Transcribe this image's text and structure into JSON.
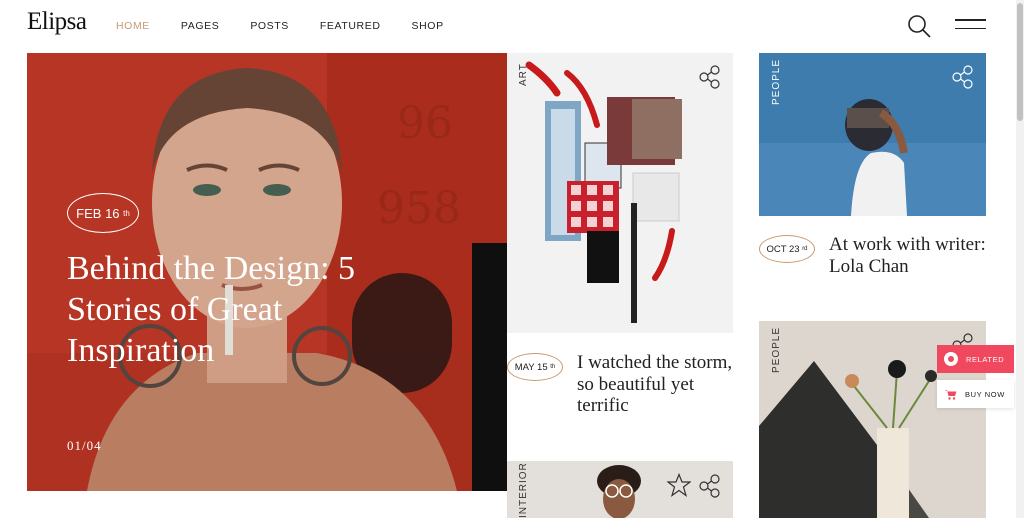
{
  "header": {
    "logo": "Elipsa",
    "nav": [
      {
        "label": "HOME",
        "active": true
      },
      {
        "label": "PAGES"
      },
      {
        "label": "POSTS"
      },
      {
        "label": "FEATURED"
      },
      {
        "label": "SHOP"
      }
    ],
    "icons": [
      "search-icon",
      "hamburger-menu-icon"
    ]
  },
  "hero": {
    "date_day": "FEB 16",
    "date_suffix": "th",
    "title": "Behind the Design: 5 Stories of Great Inspiration",
    "pager": "01/04"
  },
  "cards": [
    {
      "category": "ART",
      "date_day": "MAY 15",
      "date_suffix": "th",
      "title": "I watched the storm, so beautiful yet terrific"
    },
    {
      "category": "PEOPLE",
      "date_day": "OCT 23",
      "date_suffix": "rd",
      "title": "At work with writer: Lola Chan"
    },
    {
      "category": "INTERIOR"
    },
    {
      "category": "PEOPLE"
    }
  ],
  "floating": {
    "related_label": "RELATED",
    "buy_label": "BUY NOW"
  },
  "colors": {
    "accent": "#c79a72",
    "related": "#f0485e",
    "sky": "#4a87b8",
    "hero_red": "#c63a28"
  }
}
